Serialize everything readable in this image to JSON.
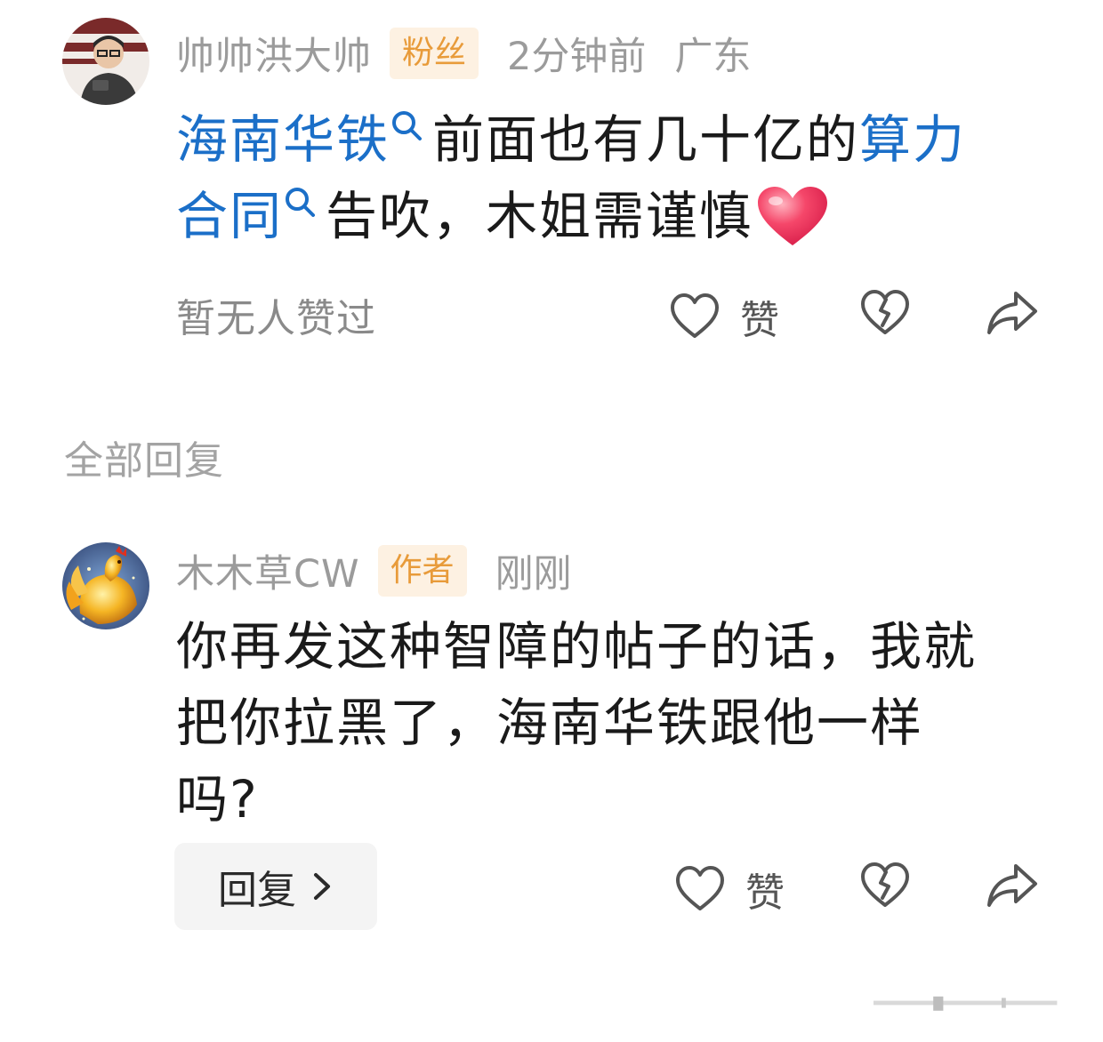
{
  "comment": {
    "username": "帅帅洪大帅",
    "badge": "粉丝",
    "time": "2分钟前",
    "location": "广东",
    "text_link1": "海南华铁",
    "text_mid1": "前面也有几十亿的",
    "text_link2a": "算力",
    "text_link2b": "合同",
    "text_end": "告吹，木姐需谨慎",
    "likes_summary": "暂无人赞过",
    "like_label": "赞",
    "icons": {
      "avatar": "avatar-man-glasses",
      "like": "heart-outline-icon",
      "dislike": "broken-heart-icon",
      "share": "share-arrow-icon",
      "search": "search-icon",
      "emoji": "red-heart-emoji"
    }
  },
  "section": {
    "title": "全部回复"
  },
  "reply": {
    "username": "木木草CW",
    "badge": "作者",
    "time": "刚刚",
    "line1": "你再发这种智障的帖子的话，我就",
    "line2": "把你拉黑了，海南华铁跟他一样",
    "line3": "吗?",
    "reply_button": "回复",
    "like_label": "赞",
    "icons": {
      "avatar": "avatar-golden-rooster",
      "like": "heart-outline-icon",
      "dislike": "broken-heart-icon",
      "share": "share-arrow-icon",
      "chevron": "chevron-right-icon"
    }
  },
  "colors": {
    "link": "#1b6fc8",
    "badge_text": "#e89b3a",
    "badge_bg": "#fdf1e2",
    "meta": "#9b9b9b"
  }
}
